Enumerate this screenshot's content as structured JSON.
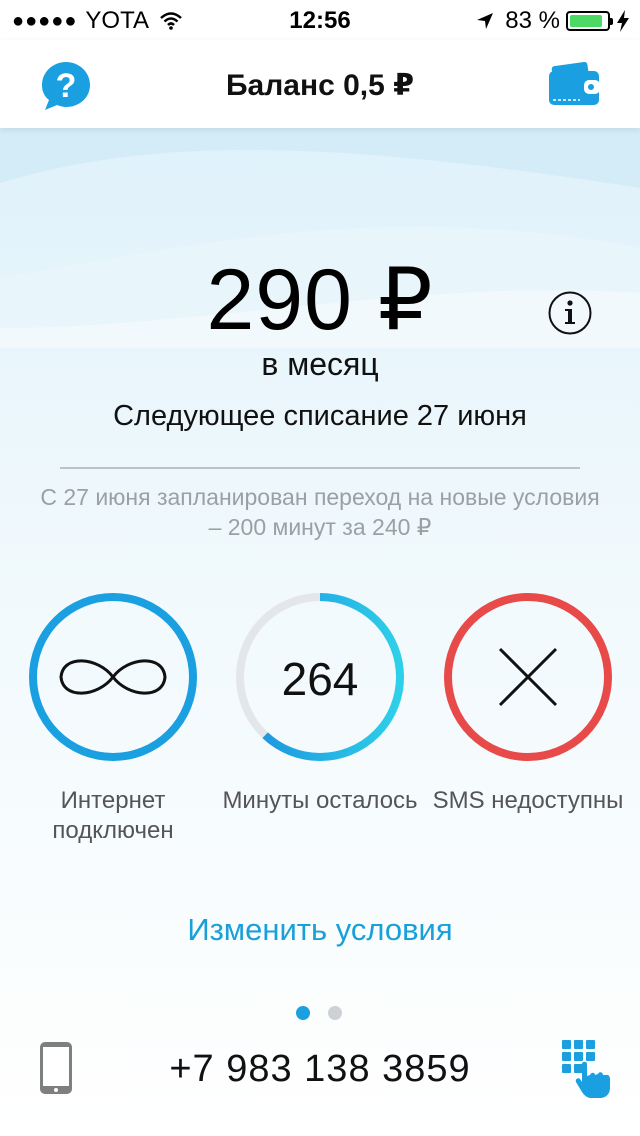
{
  "status_bar": {
    "signal": "●●●●●",
    "carrier": "YOTA",
    "time": "12:56",
    "battery_percent": "83 %",
    "battery_level": 0.83
  },
  "nav": {
    "title": "Баланс 0,5 ₽",
    "help_icon": "question-bubble-icon",
    "wallet_icon": "wallet-icon"
  },
  "plan": {
    "price": "290 ₽",
    "period": "в месяц",
    "next_charge": "Следующее списание 27 июня",
    "notice": "С 27 июня запланирован переход на новые условия – 200 минут за 240 ₽"
  },
  "indicators": [
    {
      "value": "∞",
      "label": "Интернет подключен",
      "color": "#1a9fe0"
    },
    {
      "value": "264",
      "label": "Минуты осталось",
      "color": "#1aa8e0",
      "remaining_fraction": 0.62
    },
    {
      "value": "✕",
      "label": "SMS недоступны",
      "color": "#e84a4a"
    }
  ],
  "actions": {
    "change_terms": "Изменить условия"
  },
  "pager": {
    "current_page": 1,
    "total_pages": 2
  },
  "footer": {
    "phone_number": "+7 983 138 3859"
  },
  "colors": {
    "accent": "#1a9fe0",
    "danger": "#e84a4a",
    "muted_text": "#9aa0a3"
  }
}
